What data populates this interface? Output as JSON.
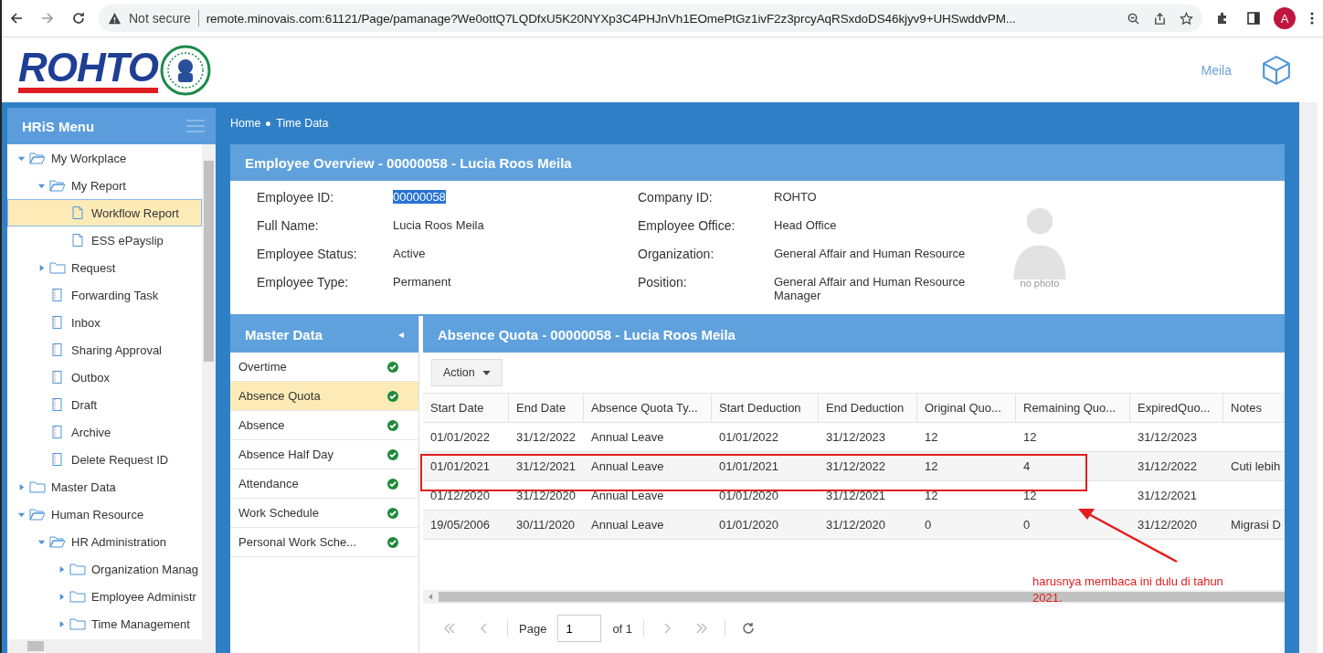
{
  "browser": {
    "security": "Not secure",
    "url": "remote.minovais.com:61121/Page/pamanage?We0ottQ7LQDfxU5K20NYXp3C4PHJnVh1EOmePtGz1ivF2z3prcyAqRSxdoDS46kjyv9+UHSwddvPM...",
    "profile_initial": "A"
  },
  "header": {
    "logo_text": "ROHTO",
    "user_name": "Meila"
  },
  "sidebar": {
    "title": "HRiS Menu",
    "items": [
      {
        "label": "My Workplace",
        "kind": "folder",
        "expanded": true,
        "selected": false,
        "children": [
          {
            "label": "My Report",
            "kind": "folder",
            "expanded": true,
            "selected": false,
            "children": [
              {
                "label": "Workflow Report",
                "kind": "doc",
                "selected": true
              },
              {
                "label": "ESS ePayslip",
                "kind": "doc",
                "selected": false
              }
            ]
          },
          {
            "label": "Request",
            "kind": "folder",
            "expanded": false,
            "selected": false
          },
          {
            "label": "Forwarding Task",
            "kind": "task",
            "selected": false
          },
          {
            "label": "Inbox",
            "kind": "task",
            "selected": false
          },
          {
            "label": "Sharing Approval",
            "kind": "task",
            "selected": false
          },
          {
            "label": "Outbox",
            "kind": "task",
            "selected": false
          },
          {
            "label": "Draft",
            "kind": "task",
            "selected": false
          },
          {
            "label": "Archive",
            "kind": "task",
            "selected": false
          },
          {
            "label": "Delete Request ID",
            "kind": "task",
            "selected": false
          }
        ]
      },
      {
        "label": "Master Data",
        "kind": "folder",
        "expanded": false,
        "selected": false
      },
      {
        "label": "Human Resource",
        "kind": "folder",
        "expanded": true,
        "selected": false,
        "children": [
          {
            "label": "HR Administration",
            "kind": "folder",
            "expanded": true,
            "selected": false,
            "children": [
              {
                "label": "Organization Manag",
                "kind": "folder",
                "expanded": false,
                "selected": false
              },
              {
                "label": "Employee Administr",
                "kind": "folder",
                "expanded": false,
                "selected": false
              },
              {
                "label": "Time Management",
                "kind": "folder",
                "expanded": false,
                "selected": false
              }
            ]
          }
        ]
      }
    ]
  },
  "breadcrumb": [
    "Home",
    "Time Data"
  ],
  "overview": {
    "title": "Employee Overview - 00000058 - Lucia Roos Meila",
    "photo_text": "no photo",
    "fields_left": [
      {
        "label": "Employee ID:",
        "value": "00000058",
        "highlighted": true
      },
      {
        "label": "Full Name:",
        "value": "Lucia Roos Meila",
        "highlighted": false
      },
      {
        "label": "Employee Status:",
        "value": "Active",
        "highlighted": false
      },
      {
        "label": "Employee Type:",
        "value": "Permanent",
        "highlighted": false
      }
    ],
    "fields_right": [
      {
        "label": "Company ID:",
        "value": "ROHTO"
      },
      {
        "label": "Employee Office:",
        "value": "Head Office"
      },
      {
        "label": "Organization:",
        "value": "General Affair and Human Resource"
      },
      {
        "label": "Position:",
        "value": "General Affair and Human Resource Manager"
      }
    ]
  },
  "master_data": {
    "title": "Master Data",
    "collapse_glyph": "◂",
    "items": [
      {
        "label": "Overtime",
        "selected": false,
        "complete": true
      },
      {
        "label": "Absence Quota",
        "selected": true,
        "complete": true
      },
      {
        "label": "Absence",
        "selected": false,
        "complete": true
      },
      {
        "label": "Absence Half Day",
        "selected": false,
        "complete": true
      },
      {
        "label": "Attendance",
        "selected": false,
        "complete": true
      },
      {
        "label": "Work Schedule",
        "selected": false,
        "complete": true
      },
      {
        "label": "Personal Work Sche...",
        "selected": false,
        "complete": true
      }
    ]
  },
  "absence_quota": {
    "title": "Absence Quota - 00000058 - Lucia Roos Meila",
    "action_button": "Action",
    "columns": [
      "Start Date",
      "End Date",
      "Absence Quota Ty...",
      "Start Deduction",
      "End Deduction",
      "Original Quo...",
      "Remaining Quo...",
      "ExpiredQuo...",
      "Notes"
    ],
    "rows": [
      [
        "01/01/2022",
        "31/12/2022",
        "Annual Leave",
        "01/01/2022",
        "31/12/2023",
        "12",
        "12",
        "31/12/2023",
        ""
      ],
      [
        "01/01/2021",
        "31/12/2021",
        "Annual Leave",
        "01/01/2021",
        "31/12/2022",
        "12",
        "4",
        "31/12/2022",
        "Cuti lebih"
      ],
      [
        "01/12/2020",
        "31/12/2020",
        "Annual Leave",
        "01/01/2020",
        "31/12/2021",
        "12",
        "12",
        "31/12/2021",
        ""
      ],
      [
        "19/05/2006",
        "30/11/2020",
        "Annual Leave",
        "01/01/2020",
        "31/12/2020",
        "0",
        "0",
        "31/12/2020",
        "Migrasi D"
      ]
    ],
    "pager": {
      "page_label": "Page",
      "page_value": "1",
      "of_label": "of 1"
    }
  },
  "annotation": {
    "text": "harusnya membaca ini dulu di tahun 2021."
  }
}
